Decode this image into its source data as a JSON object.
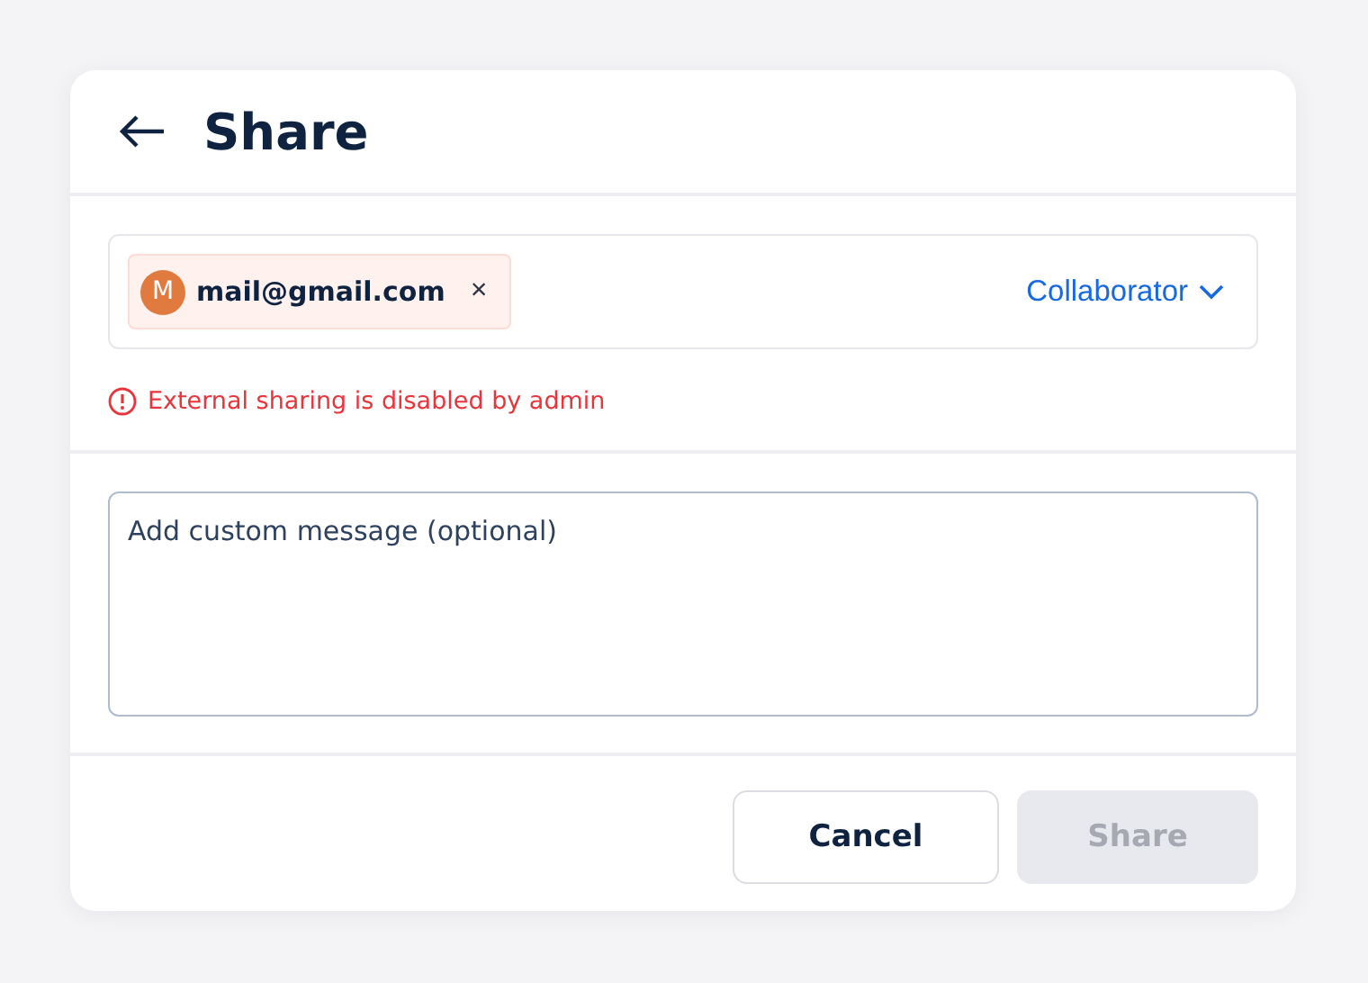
{
  "dialog": {
    "title": "Share"
  },
  "recipient": {
    "initial": "M",
    "email": "mail@gmail.com",
    "remove": "×",
    "color": "#e07a3f"
  },
  "role": {
    "label": "Collaborator"
  },
  "error": {
    "message": "External sharing is disabled by admin"
  },
  "message": {
    "placeholder": "Add custom message (optional)"
  },
  "buttons": [
    {
      "label": "Cancel",
      "kind": "secondary",
      "disabled": false
    },
    {
      "label": "Share",
      "kind": "primary",
      "disabled": true
    }
  ]
}
